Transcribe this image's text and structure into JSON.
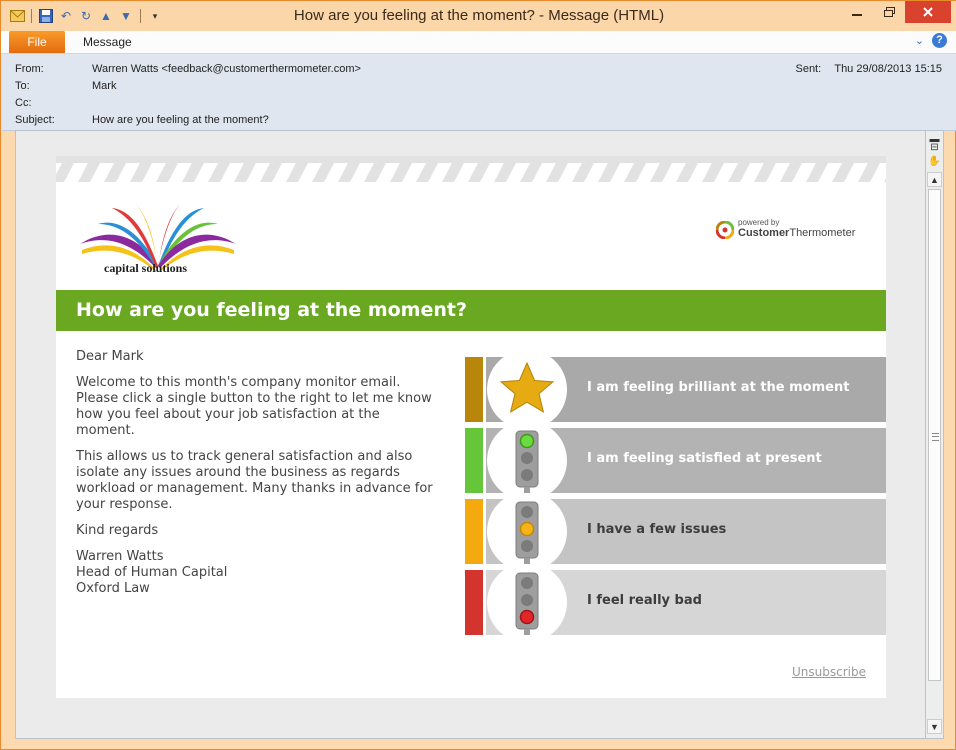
{
  "window": {
    "title": "How are you feeling at the moment?  -  Message (HTML)"
  },
  "ribbon": {
    "file_tab": "File",
    "message_tab": "Message"
  },
  "header": {
    "from_label": "From:",
    "from_value": "Warren Watts <feedback@customerthermometer.com>",
    "to_label": "To:",
    "to_value": "Mark",
    "cc_label": "Cc:",
    "cc_value": "",
    "subject_label": "Subject:",
    "subject_value": "How are you feeling at the moment?",
    "sent_label": "Sent:",
    "sent_value": "Thu 29/08/2013 15:15"
  },
  "email": {
    "logo_text": "capital solutions",
    "powered_by": "powered by",
    "brand_bold": "Customer",
    "brand_light": "Thermometer",
    "banner_title": "How are you feeling at the moment?",
    "greeting": "Dear Mark",
    "para1": "Welcome to this month's company monitor email. Please click a single button to the right to let me know how you feel about your job satisfaction at the moment.",
    "para2": "This allows us to track general satisfaction and also isolate any issues around the business as regards workload or management. Many thanks in advance for your response.",
    "closing": "Kind regards",
    "sig_name": "Warren Watts",
    "sig_title": "Head of Human Capital",
    "sig_company": "Oxford Law",
    "unsubscribe": "Unsubscribe"
  },
  "ratings": [
    {
      "label": "I am feeling brilliant at the moment",
      "icon": "star-icon",
      "accent": "#b8860b",
      "bg": "#a9a9a9"
    },
    {
      "label": "I am feeling satisfied at present",
      "icon": "green-traffic-light-icon",
      "accent": "#66c63a",
      "bg": "#b3b3b3"
    },
    {
      "label": "I have a few issues",
      "icon": "amber-traffic-light-icon",
      "accent": "#f4a90f",
      "bg": "#c4c4c4"
    },
    {
      "label": "I feel really bad",
      "icon": "red-traffic-light-icon",
      "accent": "#d4342e",
      "bg": "#d6d6d6"
    }
  ]
}
